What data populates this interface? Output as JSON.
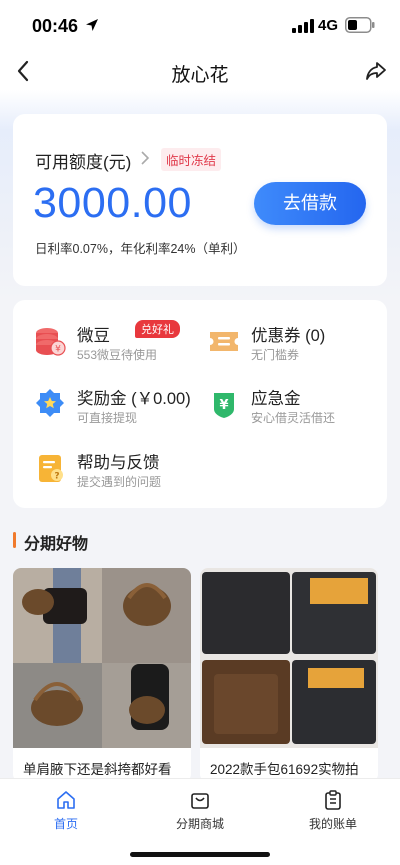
{
  "status": {
    "time": "00:46",
    "network": "4G"
  },
  "nav": {
    "title": "放心花"
  },
  "credit": {
    "label": "可用额度(元)",
    "frozen_tag": "临时冻结",
    "amount": "3000.00",
    "borrow_button": "去借款",
    "rate_text": "日利率0.07%，年化利率24%（单利）"
  },
  "services": [
    {
      "title": "微豆",
      "subtitle": "553微豆待使用",
      "badge": "兑好礼",
      "icon": "coin-stack-icon"
    },
    {
      "title": "优惠券 (0)",
      "subtitle": "无门槛券",
      "icon": "coupon-icon"
    },
    {
      "title": "奖励金 (￥0.00)",
      "subtitle": "可直接提现",
      "icon": "reward-badge-icon"
    },
    {
      "title": "应急金",
      "subtitle": "安心借灵活借还",
      "icon": "emergency-fund-icon"
    },
    {
      "title": "帮助与反馈",
      "subtitle": "提交遇到的问题",
      "icon": "help-feedback-icon"
    }
  ],
  "section": {
    "title": "分期好物"
  },
  "products": [
    {
      "name": "单肩腋下还是斜挎都好看"
    },
    {
      "name": "2022款手包61692实物拍"
    }
  ],
  "tabs": [
    {
      "label": "首页",
      "active": true
    },
    {
      "label": "分期商城",
      "active": false
    },
    {
      "label": "我的账单",
      "active": false
    }
  ],
  "colors": {
    "accent": "#2c6ef2",
    "frozen": "#e0394a",
    "badge": "#e8383d",
    "section_bar": "#f07a2c"
  }
}
